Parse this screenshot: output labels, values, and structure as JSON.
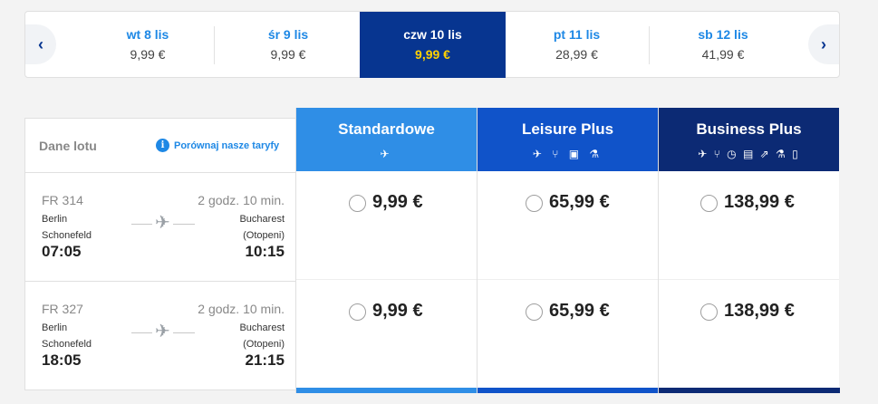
{
  "carousel": {
    "prev_icon": "chevron-left-icon",
    "next_icon": "chevron-right-icon",
    "days": [
      {
        "label": "wt 8 lis",
        "price": "9,99 €"
      },
      {
        "label": "śr 9 lis",
        "price": "9,99 €"
      },
      {
        "label": "czw 10 lis",
        "price": "9,99 €",
        "selected": true
      },
      {
        "label": "pt 11 lis",
        "price": "28,99 €"
      },
      {
        "label": "sb 12 lis",
        "price": "41,99 €"
      }
    ]
  },
  "details": {
    "heading": "Dane lotu",
    "compare_label": "Porównaj nasze taryfy",
    "flights": [
      {
        "number": "FR 314",
        "duration": "2 godz. 10 min.",
        "from_line1": "Berlin",
        "from_line2": "Schonefeld",
        "to_line1": "Bucharest",
        "to_line2": "(Otopeni)",
        "departure": "07:05",
        "arrival": "10:15"
      },
      {
        "number": "FR 327",
        "duration": "2 godz. 10 min.",
        "from_line1": "Berlin",
        "from_line2": "Schonefeld",
        "to_line1": "Bucharest",
        "to_line2": "(Otopeni)",
        "departure": "18:05",
        "arrival": "21:15"
      }
    ]
  },
  "fares": [
    {
      "name": "Standardowe",
      "color": "#2f8ee6",
      "icons": "✈",
      "prices": [
        "9,99 €",
        "9,99 €"
      ]
    },
    {
      "name": "Leisure Plus",
      "color": "#1053c9",
      "icons": "✈ ⑂ ▣ ⚗",
      "prices": [
        "65,99 €",
        "65,99 €"
      ]
    },
    {
      "name": "Business Plus",
      "color": "#0c2a74",
      "icons": "✈ ⑂ ◷ ▤ ⇗ ⚗ ▯",
      "prices": [
        "138,99 €",
        "138,99 €"
      ]
    }
  ]
}
